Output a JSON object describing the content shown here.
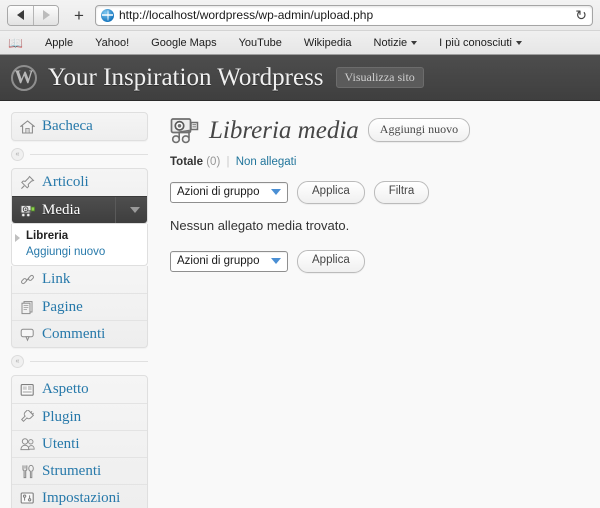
{
  "browser": {
    "back_icon": "triangle-left-icon",
    "forward_icon": "triangle-right-icon",
    "new_tab_label": "+",
    "url": "http://localhost/wordpress/wp-admin/upload.php",
    "reload_glyph": "↻",
    "bookmarks_icon": "book-icon",
    "bookmarks": [
      {
        "label": "Apple",
        "has_caret": false
      },
      {
        "label": "Yahoo!",
        "has_caret": false
      },
      {
        "label": "Google Maps",
        "has_caret": false
      },
      {
        "label": "YouTube",
        "has_caret": false
      },
      {
        "label": "Wikipedia",
        "has_caret": false
      },
      {
        "label": "Notizie",
        "has_caret": true
      },
      {
        "label": "I più conosciuti",
        "has_caret": true
      }
    ]
  },
  "header": {
    "logo_glyph": "W",
    "site_title": "Your Inspiration Wordpress",
    "view_site_label": "Visualizza sito"
  },
  "sidebar": {
    "group1": [
      {
        "label": "Bacheca",
        "icon": "dashboard-home-icon"
      }
    ],
    "group2": [
      {
        "label": "Articoli",
        "icon": "pin-icon"
      },
      {
        "label": "Media",
        "icon": "media-camera-icon",
        "active": true
      },
      {
        "label": "Link",
        "icon": "link-chain-icon"
      },
      {
        "label": "Pagine",
        "icon": "pages-icon"
      },
      {
        "label": "Commenti",
        "icon": "comment-bubble-icon"
      }
    ],
    "media_submenu": [
      {
        "label": "Libreria",
        "current": true
      },
      {
        "label": "Aggiungi nuovo",
        "current": false
      }
    ],
    "group3": [
      {
        "label": "Aspetto",
        "icon": "appearance-icon"
      },
      {
        "label": "Plugin",
        "icon": "plugin-plug-icon"
      },
      {
        "label": "Utenti",
        "icon": "users-icon"
      },
      {
        "label": "Strumenti",
        "icon": "tools-icon"
      },
      {
        "label": "Impostazioni",
        "icon": "settings-icon"
      }
    ],
    "collapse_glyph": "«"
  },
  "main": {
    "page_icon": "media-library-icon",
    "page_title": "Libreria media",
    "add_new_label": "Aggiungi nuovo",
    "filters": {
      "total_label": "Totale",
      "total_count": "(0)",
      "separator": "|",
      "unattached_label": "Non allegati"
    },
    "tablenav_top": {
      "bulk_select_value": "Azioni di gruppo",
      "apply_label": "Applica",
      "filter_label": "Filtra"
    },
    "empty_message": "Nessun allegato media trovato.",
    "tablenav_bottom": {
      "bulk_select_value": "Azioni di gruppo",
      "apply_label": "Applica"
    }
  },
  "colors": {
    "header_bg": "#464646",
    "link_blue": "#21759b",
    "page_bg": "#f9f9f9",
    "select_chevron": "#4a8fd4"
  }
}
